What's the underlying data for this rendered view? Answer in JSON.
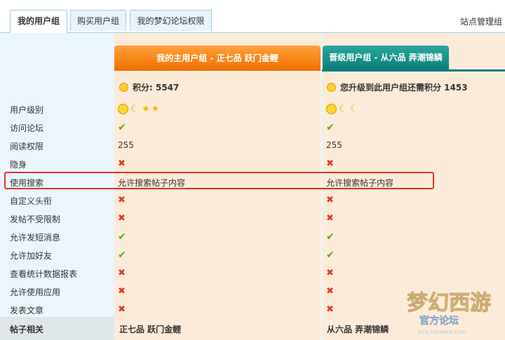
{
  "tabs": [
    {
      "label": "我的用户组",
      "active": true
    },
    {
      "label": "购买用户组",
      "active": false
    },
    {
      "label": "我的梦幻论坛权限",
      "active": false
    }
  ],
  "site_admin": "站点管理组",
  "main_group": {
    "title": "我的主用户组 - 正七品 跃门金鲤",
    "points": "积分: 5547",
    "short_name": "正七品 跃门金鲤"
  },
  "upgrade_group": {
    "title": "晋级用户组 - 从六品 弄潮锦鳞",
    "points": "您升级到此用户组还需积分 1453",
    "short_name": "从六品 弄潮锦鳞"
  },
  "rows": [
    {
      "label": "用户级别",
      "main": "level",
      "upg": "level"
    },
    {
      "label": "访问论坛",
      "main": "yes",
      "upg": "yes"
    },
    {
      "label": "阅读权限",
      "main": "255",
      "upg": "255"
    },
    {
      "label": "隐身",
      "main": "no",
      "upg": "no"
    },
    {
      "label": "使用搜索",
      "main": "允许搜索帖子内容",
      "upg": "允许搜索帖子内容"
    },
    {
      "label": "自定义头衔",
      "main": "no",
      "upg": "no"
    },
    {
      "label": "发帖不受限制",
      "main": "no",
      "upg": "no"
    },
    {
      "label": "允许发短消息",
      "main": "yes",
      "upg": "yes"
    },
    {
      "label": "允许加好友",
      "main": "yes",
      "upg": "yes"
    },
    {
      "label": "查看统计数据报表",
      "main": "no",
      "upg": "no"
    },
    {
      "label": "允许使用应用",
      "main": "no",
      "upg": "no"
    },
    {
      "label": "发表文章",
      "main": "no",
      "upg": "no"
    }
  ],
  "footer_label": "帖子相关",
  "watermark": {
    "brand": "梦幻西游",
    "subtitle": "官方论坛",
    "url": "xyq.netease.com"
  },
  "colors": {
    "accent_orange": "#f06d00",
    "accent_teal": "#0b7f79",
    "highlight": "#e8312e"
  }
}
